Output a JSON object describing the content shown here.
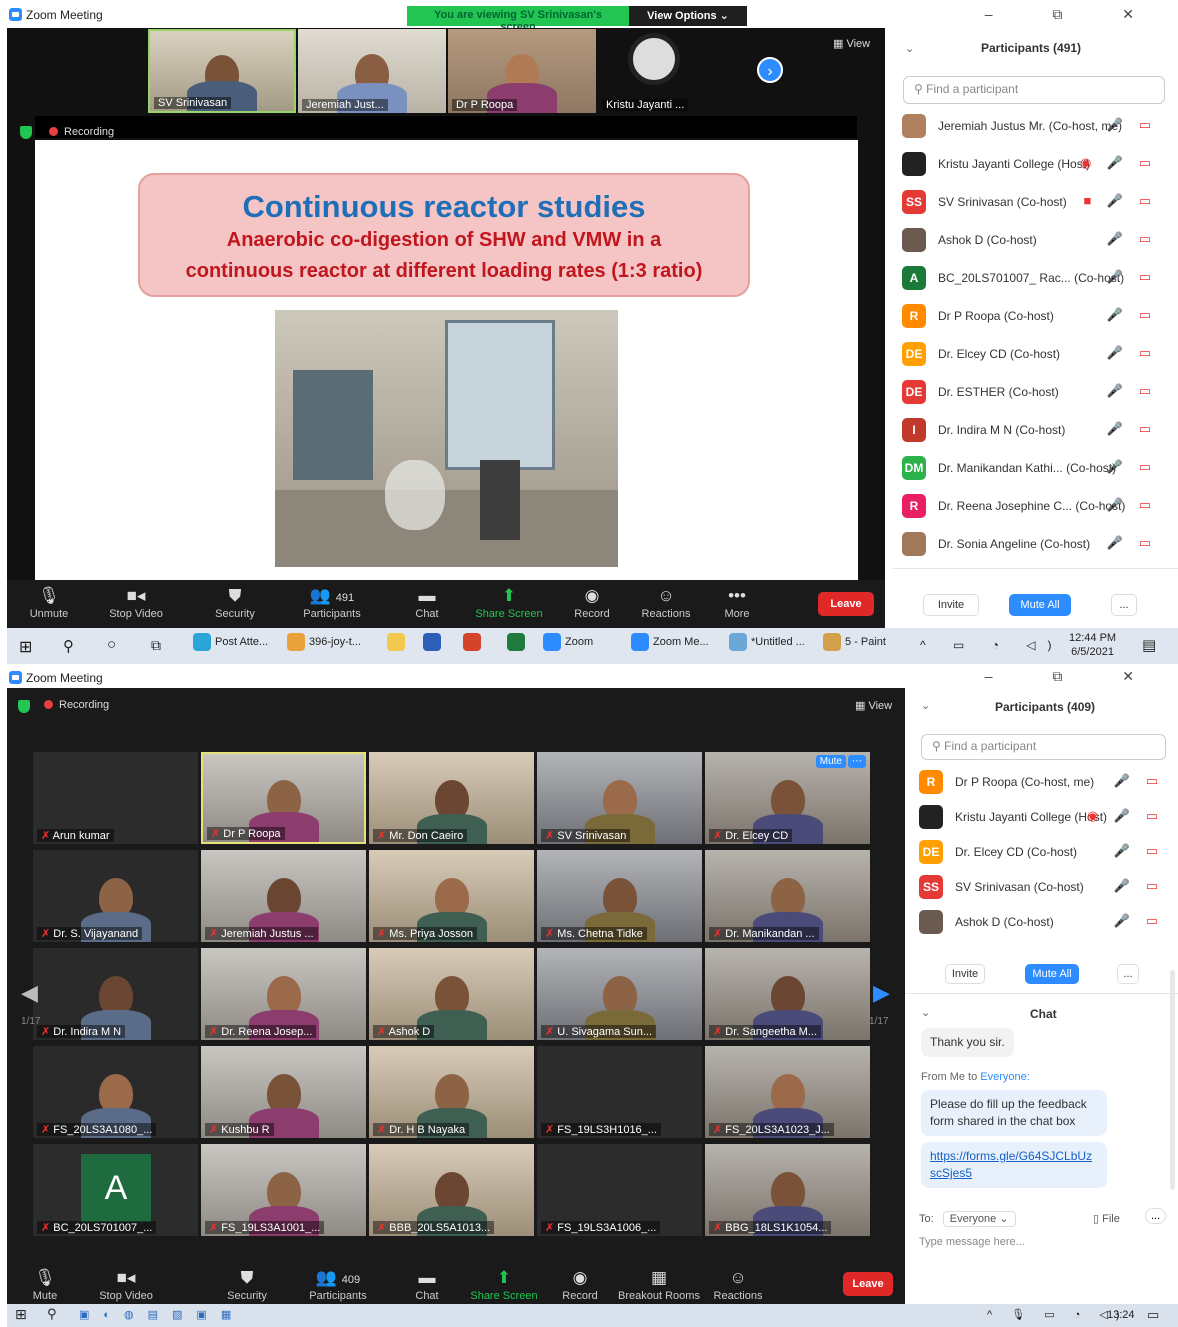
{
  "top": {
    "window_title": "Zoom Meeting",
    "window_controls": "–  ⧉  ✕",
    "banner": "You are viewing SV Srinivasan's screen",
    "view_options": "View Options ⌄",
    "view_label": "View",
    "recording": "Recording",
    "thumbnails": [
      {
        "name": "SV Srinivasan"
      },
      {
        "name": "Jeremiah Just..."
      },
      {
        "name": "Dr P Roopa"
      },
      {
        "name": "Kristu Jayanti ..."
      }
    ],
    "slide": {
      "title": "Continuous reactor studies",
      "line1": "Anaerobic co-digestion of SHW and VMW in a",
      "line2": "continuous reactor at different loading rates (1:3 ratio)"
    },
    "toolbar": {
      "unmute": "Unmute",
      "stop_video": "Stop Video",
      "security": "Security",
      "participants": "Participants",
      "participants_count": "491",
      "chat": "Chat",
      "share_screen": "Share Screen",
      "record": "Record",
      "reactions": "Reactions",
      "more": "More",
      "leave": "Leave"
    },
    "panel": {
      "title": "Participants (491)",
      "search_placeholder": "Find a participant",
      "participants": [
        {
          "name": "Jeremiah Justus Mr. (Co-host, me)",
          "initials": "",
          "color": "#b08060",
          "icons": "🎤 ▭"
        },
        {
          "name": "Kristu Jayanti College (Host)",
          "initials": "",
          "color": "#222222",
          "icons": "◉ 🎤 ▭"
        },
        {
          "name": "SV Srinivasan (Co-host)",
          "initials": "SS",
          "color": "#e53935",
          "icons": "■ 🎤 ▭"
        },
        {
          "name": "Ashok D (Co-host)",
          "initials": "",
          "color": "#6a5a50",
          "icons": "🎤 ▭"
        },
        {
          "name": "BC_20LS701007_ Rac...  (Co-host)",
          "initials": "A",
          "color": "#1b7a3a",
          "icons": "🎤 ▭"
        },
        {
          "name": "Dr P Roopa (Co-host)",
          "initials": "R",
          "color": "#ff8a00",
          "icons": "🎤 ▭"
        },
        {
          "name": "Dr. Elcey CD (Co-host)",
          "initials": "DE",
          "color": "#ffa000",
          "icons": "🎤 ▭"
        },
        {
          "name": "Dr. ESTHER (Co-host)",
          "initials": "DE",
          "color": "#e53935",
          "icons": "🎤 ▭"
        },
        {
          "name": "Dr. Indira M N (Co-host)",
          "initials": "I",
          "color": "#c0392b",
          "icons": "🎤 ▭"
        },
        {
          "name": "Dr. Manikandan Kathi...  (Co-host)",
          "initials": "DM",
          "color": "#2bb24c",
          "icons": "🎤 ▭"
        },
        {
          "name": "Dr. Reena Josephine C...  (Co-host)",
          "initials": "R",
          "color": "#e91e63",
          "icons": "🎤 ▭"
        },
        {
          "name": "Dr. Sonia Angeline (Co-host)",
          "initials": "",
          "color": "#a0785a",
          "icons": "🎤 ▭"
        }
      ],
      "invite": "Invite",
      "mute_all": "Mute All",
      "more": "..."
    },
    "taskbar": {
      "items": [
        "Post Atte...",
        "396-joy-t...",
        "",
        "",
        "",
        "",
        "Zoom",
        "Zoom Me...",
        "*Untitled ...",
        "5 - Paint"
      ],
      "time": "12:44 PM",
      "date": "6/5/2021"
    }
  },
  "bottom": {
    "window_title": "Zoom Meeting",
    "window_controls": "–  ⧉  ✕",
    "recording": "Recording",
    "view_label": "View",
    "page_left": "1/17",
    "page_right": "1/17",
    "mute_chip": "Mute",
    "tiles": [
      "Arun kumar",
      "Dr P Roopa",
      "Mr. Don Caeiro",
      "SV Srinivasan",
      "Dr. Elcey CD",
      "Dr. S. Vijayanand",
      "Jeremiah Justus ...",
      "Ms. Priya Josson",
      "Ms. Chetna Tidke",
      "Dr. Manikandan ...",
      "Dr. Indira M N",
      "Dr. Reena Josep...",
      "Ashok D",
      "U. Sivagama Sun...",
      "Dr. Sangeetha M...",
      "FS_20LS3A1080_...",
      "Kushbu R",
      "Dr. H B Nayaka",
      "FS_19LS3H1016_...",
      "FS_20LS3A1023_J...",
      "BC_20LS701007_...",
      "FS_19LS3A1001_...",
      "BBB_20LS5A1013...",
      "FS_19LS3A1006_...",
      "BBG_18LS1K1054..."
    ],
    "big_initial": "A",
    "toolbar": {
      "mute": "Mute",
      "stop_video": "Stop Video",
      "security": "Security",
      "participants": "Participants",
      "participants_count": "409",
      "chat": "Chat",
      "share_screen": "Share Screen",
      "record": "Record",
      "breakout": "Breakout Rooms",
      "reactions": "Reactions",
      "leave": "Leave"
    },
    "panel": {
      "title": "Participants (409)",
      "search_placeholder": "Find a participant",
      "participants": [
        {
          "name": "Dr P Roopa (Co-host, me)",
          "initials": "R",
          "color": "#ff8a00",
          "icons": "🎤 ▭"
        },
        {
          "name": "Kristu Jayanti College (Host)",
          "initials": "",
          "color": "#222222",
          "icons": "◉ 🎤 ▭"
        },
        {
          "name": "Dr. Elcey CD (Co-host)",
          "initials": "DE",
          "color": "#ffa000",
          "icons": "🎤 ▭"
        },
        {
          "name": "SV Srinivasan (Co-host)",
          "initials": "SS",
          "color": "#e53935",
          "icons": "🎤 ▭"
        },
        {
          "name": "Ashok D (Co-host)",
          "initials": "",
          "color": "#6a5a50",
          "icons": "🎤 ▭"
        }
      ],
      "invite": "Invite",
      "mute_all": "Mute All",
      "more": "..."
    },
    "chat": {
      "title": "Chat",
      "msg_prev": "Thank you sir.",
      "from_label": "From Me to",
      "from_target": "Everyone:",
      "msg1": "Please do fill up the feedback form shared in the chat box",
      "link": "https://forms.gle/G64SJCLbUzscSjes5",
      "to_label": "To:",
      "to_value": "Everyone ⌄",
      "file": "File",
      "more": "...",
      "placeholder": "Type message here..."
    },
    "taskbar": {
      "time": "13:24"
    }
  },
  "colors": {
    "zoom_blue": "#2d8cff",
    "leave_red": "#e02828",
    "share_green": "#23c552"
  }
}
